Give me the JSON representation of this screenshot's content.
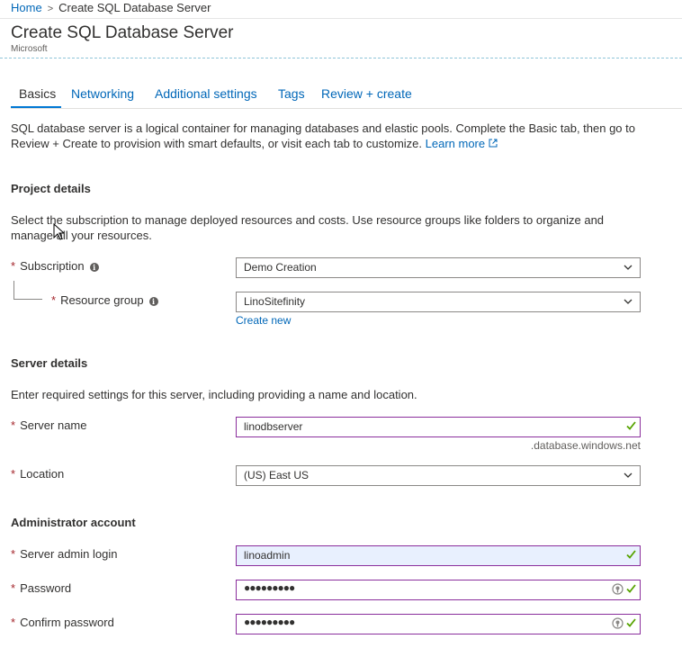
{
  "breadcrumb": {
    "home": "Home",
    "separator": ">",
    "current": "Create SQL Database Server"
  },
  "header": {
    "title": "Create SQL Database Server",
    "publisher": "Microsoft"
  },
  "tabs": [
    {
      "label": "Basics",
      "active": true
    },
    {
      "label": "Networking",
      "active": false
    },
    {
      "label": "Additional settings",
      "active": false
    },
    {
      "label": "Tags",
      "active": false
    },
    {
      "label": "Review + create",
      "active": false
    }
  ],
  "intro": {
    "text": "SQL database server is a logical container for managing databases and elastic pools. Complete the Basic tab, then go to Review + Create to provision with smart defaults, or visit each tab to customize.",
    "link": "Learn more",
    "link_icon": "external-link-icon"
  },
  "project": {
    "heading": "Project details",
    "description": "Select the subscription to manage deployed resources and costs. Use resource groups like folders to organize and manage all your resources.",
    "subscription": {
      "label": "Subscription",
      "value": "Demo Creation"
    },
    "resource_group": {
      "label": "Resource group",
      "value": "LinoSitefinity",
      "create_new": "Create new"
    }
  },
  "server": {
    "heading": "Server details",
    "description": "Enter required settings for this server, including providing a name and location.",
    "name": {
      "label": "Server name",
      "value": "linodbserver",
      "suffix": ".database.windows.net"
    },
    "location": {
      "label": "Location",
      "value": "(US) East US"
    }
  },
  "admin": {
    "heading": "Administrator account",
    "login": {
      "label": "Server admin login",
      "value": "linoadmin"
    },
    "password": {
      "label": "Password",
      "value": "●●●●●●●●●"
    },
    "confirm": {
      "label": "Confirm password",
      "value": "●●●●●●●●●"
    }
  },
  "required_marker": "*",
  "info_glyph": "i",
  "colors": {
    "accent": "#0078d4",
    "link": "#0067b8",
    "valid_border": "#8a2e9c",
    "check": "#57a300",
    "required": "#a4262c"
  }
}
